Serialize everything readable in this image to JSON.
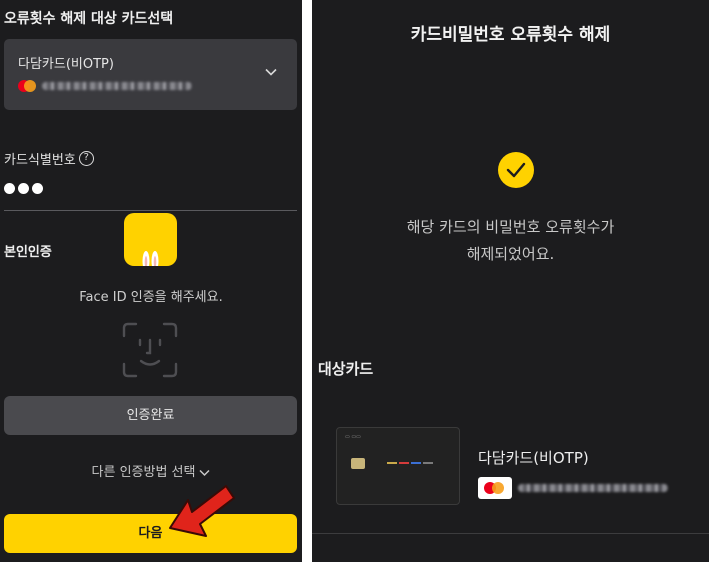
{
  "left_screen": {
    "section_title": "오류횟수 해제 대상 카드선택",
    "card_select": {
      "card_name": "다담카드(비OTP)",
      "chevron_icon": "chevron-down-icon"
    },
    "card_id_label": "카드식별번호",
    "help_icon_glyph": "?",
    "pin_length": 3,
    "auth_label": "본인인증",
    "faceid_prompt": "Face ID 인증을 해주세요.",
    "auth_complete_button": "인증완료",
    "other_method_link": "다른 인증방법 선택",
    "next_button": "다음"
  },
  "right_screen": {
    "title": "카드비밀번호 오류횟수 해제",
    "success_message_line1": "해당 카드의 비밀번호 오류횟수가",
    "success_message_line2": "해제되었어요.",
    "target_label": "대상카드",
    "card_name": "다담카드(비OTP)"
  },
  "colors": {
    "background": "#1c1c1e",
    "accent": "#ffd200",
    "button_gray": "#4a4a4e",
    "arrow_red": "#e0241b"
  }
}
